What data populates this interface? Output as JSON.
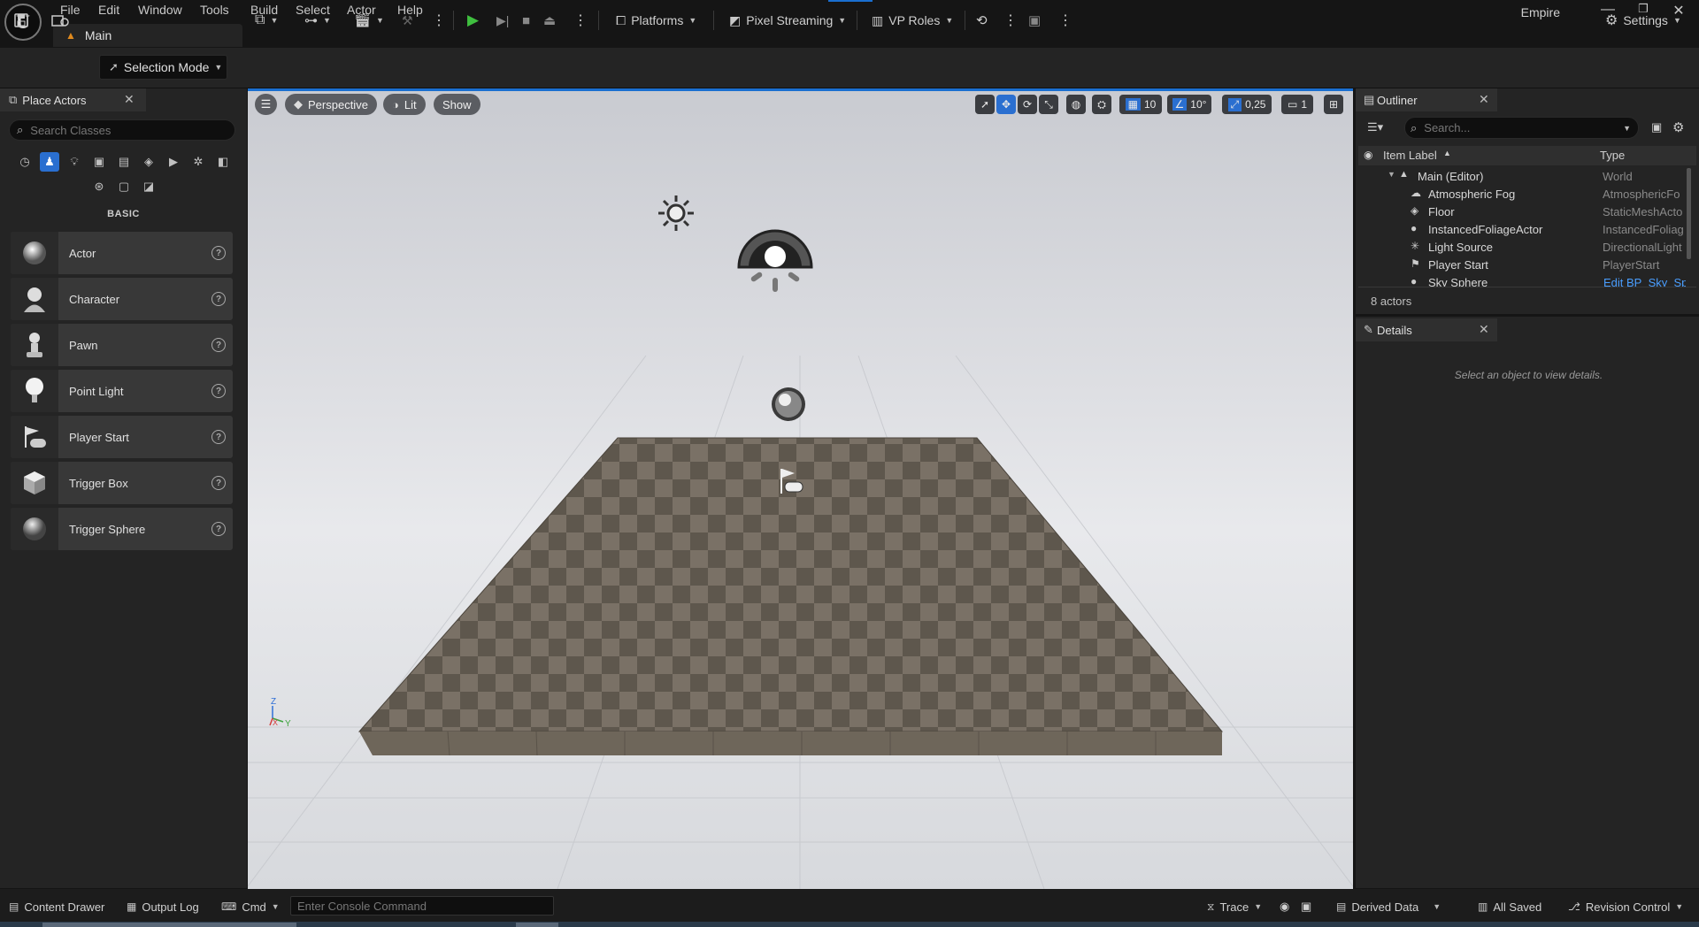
{
  "app": {
    "logo": "U",
    "project_name": "Empire",
    "level_tab": "Main"
  },
  "menu": [
    {
      "label": "File"
    },
    {
      "label": "Edit"
    },
    {
      "label": "Window"
    },
    {
      "label": "Tools"
    },
    {
      "label": "Build"
    },
    {
      "label": "Select"
    },
    {
      "label": "Actor"
    },
    {
      "label": "Help"
    }
  ],
  "toolbar": {
    "selection_mode": "Selection Mode",
    "platforms": "Platforms",
    "pixel_streaming": "Pixel Streaming",
    "vp_roles": "VP Roles",
    "settings": "Settings"
  },
  "place_actors": {
    "title": "Place Actors",
    "search_placeholder": "Search Classes",
    "category": "BASIC",
    "items": [
      {
        "label": "Actor"
      },
      {
        "label": "Character"
      },
      {
        "label": "Pawn"
      },
      {
        "label": "Point Light"
      },
      {
        "label": "Player Start"
      },
      {
        "label": "Trigger Box"
      },
      {
        "label": "Trigger Sphere"
      }
    ]
  },
  "viewport": {
    "perspective": "Perspective",
    "lit": "Lit",
    "show": "Show",
    "grid_snap": "10",
    "rotation_snap": "10°",
    "scale_snap": "0,25",
    "camera_speed": "1"
  },
  "outliner": {
    "title": "Outliner",
    "search_placeholder": "Search...",
    "col_label": "Item Label",
    "col_type": "Type",
    "actor_count": "8 actors",
    "rows": [
      {
        "label": "Main (Editor)",
        "type": "World"
      },
      {
        "label": "Atmospheric Fog",
        "type": "AtmosphericFo"
      },
      {
        "label": "Floor",
        "type": "StaticMeshActo"
      },
      {
        "label": "InstancedFoliageActor",
        "type": "InstancedFoliag"
      },
      {
        "label": "Light Source",
        "type": "DirectionalLight"
      },
      {
        "label": "Player Start",
        "type": "PlayerStart"
      },
      {
        "label": "Sky Sphere",
        "type": "Edit BP_Sky_Sp"
      }
    ]
  },
  "details": {
    "title": "Details",
    "empty_text": "Select an object to view details."
  },
  "bottom": {
    "content_drawer": "Content Drawer",
    "output_log": "Output Log",
    "cmd": "Cmd",
    "console_placeholder": "Enter Console Command",
    "trace": "Trace",
    "derived_data": "Derived Data",
    "all_saved": "All Saved",
    "revision_control": "Revision Control"
  },
  "colors": {
    "accent": "#1a6fd0",
    "play": "#3fbf3f",
    "link": "#4a9eff"
  }
}
